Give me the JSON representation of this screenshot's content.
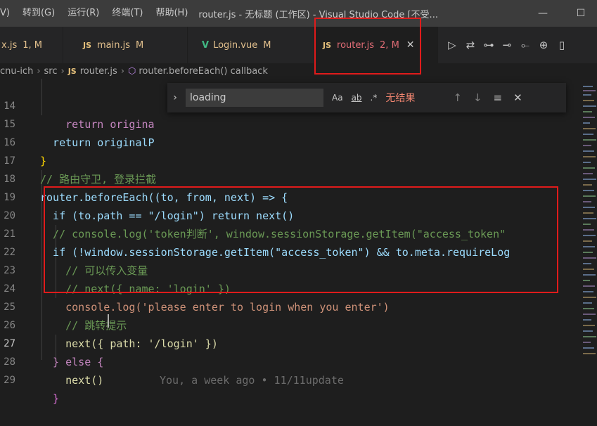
{
  "titlebar": {
    "menus": [
      "V)",
      "转到(G)",
      "运行(R)",
      "终端(T)",
      "帮助(H)"
    ],
    "title": "router.js - 无标题 (工作区) - Visual Studio Code [不受...",
    "minimize": "—",
    "maximize": "☐"
  },
  "tabs": [
    {
      "icon": "",
      "label": "x.js",
      "status": "1, M"
    },
    {
      "icon": "JS",
      "label": "main.js",
      "status": "M"
    },
    {
      "icon": "V",
      "label": "Login.vue",
      "status": "M"
    },
    {
      "icon": "JS",
      "label": "router.js",
      "status": "2, M",
      "close": "✕"
    }
  ],
  "breadcrumb": {
    "items": [
      "cnu-ich",
      "src",
      "router.js",
      "router.beforeEach() callback"
    ],
    "js_icon": "JS"
  },
  "find": {
    "value": "loading",
    "match_case": "Aa",
    "whole_word": "ab",
    "regex": ".*",
    "result": "无结果"
  },
  "lines": [
    {
      "n": "14",
      "code": "    return origina"
    },
    {
      "n": "15",
      "code": "  return originalP"
    },
    {
      "n": "16",
      "code": "}"
    },
    {
      "n": "17",
      "code": "// 路由守卫, 登录拦截"
    },
    {
      "n": "18",
      "code": "router.beforeEach((to, from, next) => {"
    },
    {
      "n": "19",
      "code": "  if (to.path == \"/login\") return next()"
    },
    {
      "n": "20",
      "code": "  // console.log('token判断', window.sessionStorage.getItem(\"access_token\""
    },
    {
      "n": "21",
      "code": "  if (!window.sessionStorage.getItem(\"access_token\") && to.meta.requireLog"
    },
    {
      "n": "22",
      "code": "    // 可以传入变量"
    },
    {
      "n": "23",
      "code": "    // next({ name: 'login' })"
    },
    {
      "n": "24",
      "code": "    console.log('please enter to login when you enter')"
    },
    {
      "n": "25",
      "code": "    // 跳转提示"
    },
    {
      "n": "26",
      "code": "    next({ path: '/login' })"
    },
    {
      "n": "27",
      "code": "  } else {"
    },
    {
      "n": "28",
      "code": "    next()"
    },
    {
      "n": "29",
      "code": "  }"
    }
  ],
  "blame": "You, a week ago • 11/11update",
  "colors": {
    "accent_red": "#e01b1b",
    "modified": "#e2c08d",
    "error_tab": "#e06c75"
  }
}
